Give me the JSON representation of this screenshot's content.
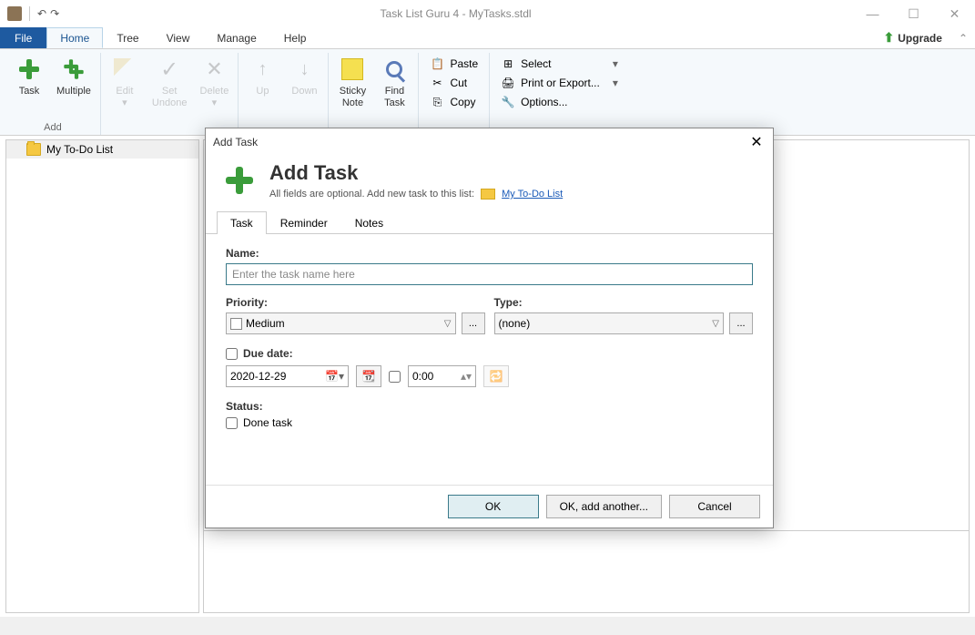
{
  "titlebar": {
    "title": "Task List Guru 4 - MyTasks.stdl"
  },
  "menubar": {
    "file": "File",
    "items": [
      "Home",
      "Tree",
      "View",
      "Manage",
      "Help"
    ],
    "upgrade": "Upgrade"
  },
  "ribbon": {
    "add_group": "Add",
    "task": "Task",
    "multiple": "Multiple",
    "edit": "Edit",
    "set_undone": "Set\nUndone",
    "delete": "Delete",
    "up": "Up",
    "down": "Down",
    "sticky_note": "Sticky\nNote",
    "find_task": "Find\nTask",
    "paste": "Paste",
    "cut": "Cut",
    "copy": "Copy",
    "select": "Select",
    "print_export": "Print or Export...",
    "options": "Options..."
  },
  "sidebar": {
    "list_name": "My To-Do List"
  },
  "dialog": {
    "title": "Add Task",
    "header": "Add Task",
    "subtitle": "All fields are optional. Add new task to this list:",
    "link": "My To-Do List",
    "tabs": [
      "Task",
      "Reminder",
      "Notes"
    ],
    "name_label": "Name:",
    "name_placeholder": "Enter the task name here",
    "priority_label": "Priority:",
    "priority_value": "Medium",
    "type_label": "Type:",
    "type_value": "(none)",
    "ellipsis": "...",
    "due_date_label": "Due date:",
    "due_date_value": "2020-12-29",
    "time_value": "0:00",
    "status_label": "Status:",
    "done_task": "Done task",
    "ok": "OK",
    "ok_another": "OK, add another...",
    "cancel": "Cancel"
  }
}
